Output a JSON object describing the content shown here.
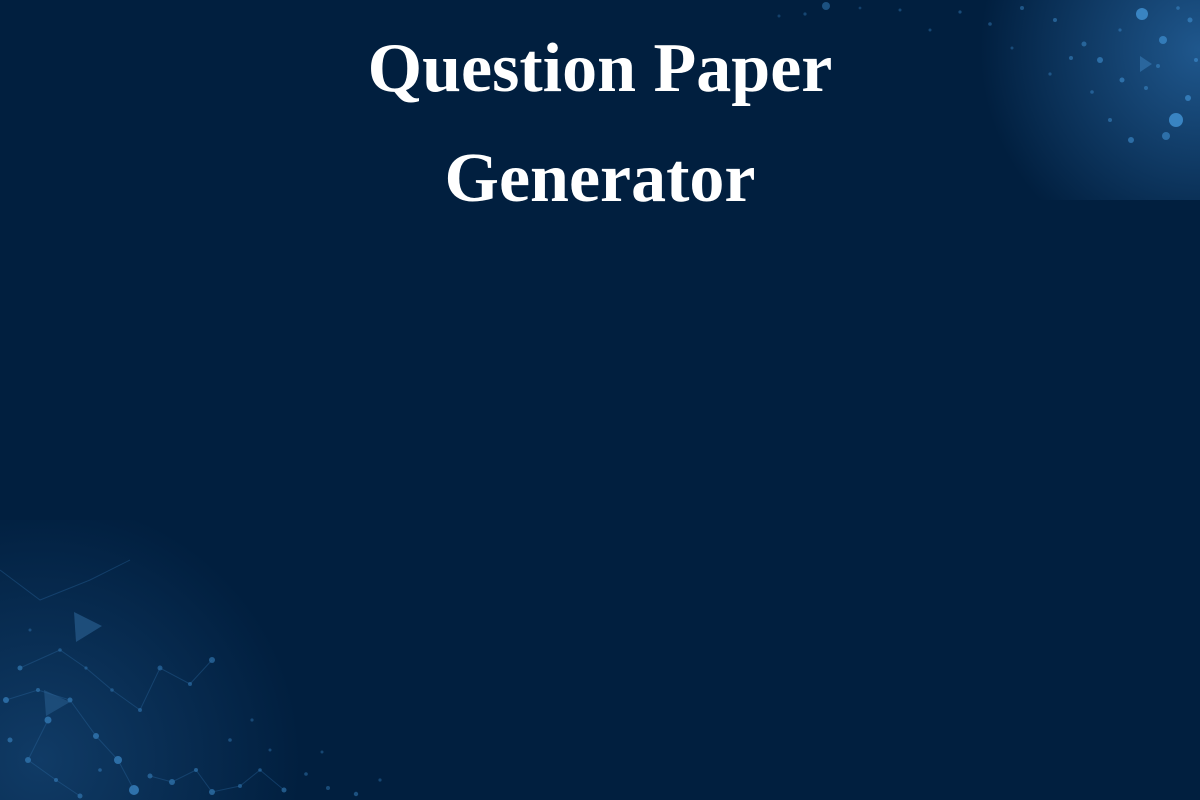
{
  "slide": {
    "title_lines": [
      "Question Paper",
      "Generator"
    ]
  },
  "colors": {
    "background": "#011f3f",
    "title": "#ffffff",
    "particle_accent": "#3f8fd0"
  },
  "decoration": {
    "icon": "particle-network-pattern"
  }
}
